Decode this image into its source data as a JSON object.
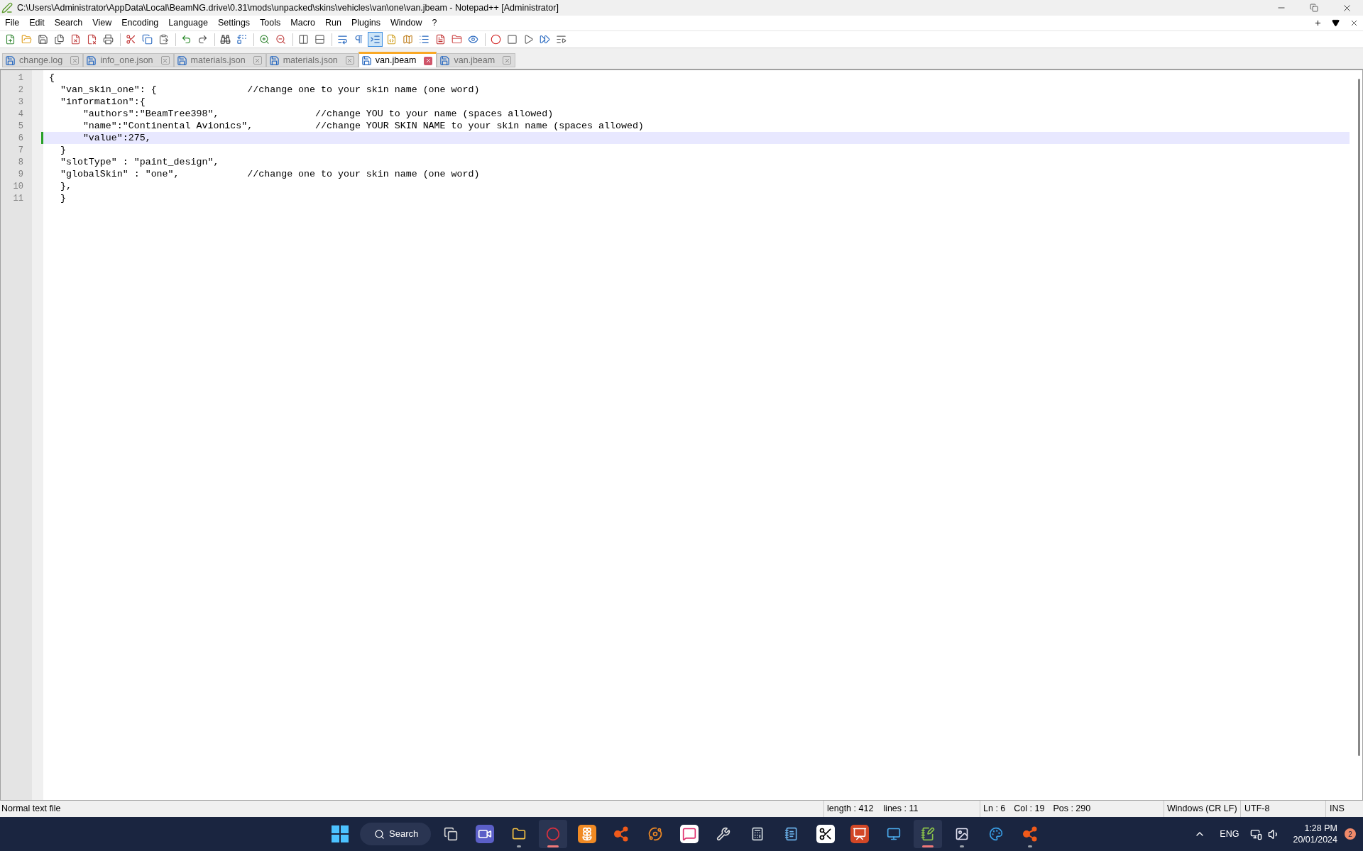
{
  "window": {
    "title": "C:\\Users\\Administrator\\AppData\\Local\\BeamNG.drive\\0.31\\mods\\unpacked\\skins\\vehicles\\van\\one\\van.jbeam - Notepad++ [Administrator]"
  },
  "menu": [
    "File",
    "Edit",
    "Search",
    "View",
    "Encoding",
    "Language",
    "Settings",
    "Tools",
    "Macro",
    "Run",
    "Plugins",
    "Window",
    "?"
  ],
  "toolbar": [
    {
      "kind": "new",
      "pressed": false
    },
    {
      "kind": "open",
      "pressed": false
    },
    {
      "kind": "save",
      "pressed": false
    },
    {
      "kind": "save-all",
      "pressed": false
    },
    {
      "kind": "close",
      "pressed": false
    },
    {
      "kind": "close-all",
      "pressed": false
    },
    {
      "kind": "print",
      "pressed": false
    },
    {
      "kind": "separator"
    },
    {
      "kind": "cut",
      "pressed": false
    },
    {
      "kind": "copy",
      "pressed": false
    },
    {
      "kind": "paste",
      "pressed": false
    },
    {
      "kind": "separator"
    },
    {
      "kind": "undo",
      "pressed": false
    },
    {
      "kind": "redo",
      "pressed": false
    },
    {
      "kind": "separator"
    },
    {
      "kind": "find",
      "pressed": false
    },
    {
      "kind": "replace",
      "pressed": false
    },
    {
      "kind": "separator"
    },
    {
      "kind": "zoom-in",
      "pressed": false
    },
    {
      "kind": "zoom-out",
      "pressed": false
    },
    {
      "kind": "separator"
    },
    {
      "kind": "sync-v",
      "pressed": false
    },
    {
      "kind": "sync-h",
      "pressed": false
    },
    {
      "kind": "separator"
    },
    {
      "kind": "wrap",
      "pressed": false
    },
    {
      "kind": "all-chars",
      "pressed": false
    },
    {
      "kind": "indent-guide",
      "pressed": true
    },
    {
      "kind": "udl",
      "pressed": false
    },
    {
      "kind": "doc-map",
      "pressed": false
    },
    {
      "kind": "doc-list",
      "pressed": false
    },
    {
      "kind": "function-list",
      "pressed": false
    },
    {
      "kind": "workspace",
      "pressed": false
    },
    {
      "kind": "monitor",
      "pressed": false
    },
    {
      "kind": "separator"
    },
    {
      "kind": "record",
      "pressed": false
    },
    {
      "kind": "stop",
      "pressed": false
    },
    {
      "kind": "play",
      "pressed": false
    },
    {
      "kind": "play-multi",
      "pressed": false
    },
    {
      "kind": "save-macro",
      "pressed": false
    }
  ],
  "tabs": [
    {
      "label": "change.log",
      "selected": false
    },
    {
      "label": "info_one.json",
      "selected": false
    },
    {
      "label": "materials.json",
      "selected": false
    },
    {
      "label": "materials.json",
      "selected": false
    },
    {
      "label": "van.jbeam",
      "selected": true
    },
    {
      "label": "van.jbeam",
      "selected": false
    }
  ],
  "editor": {
    "lines": [
      {
        "number": "1",
        "text": "{",
        "current": false,
        "changed": false
      },
      {
        "number": "2",
        "text": "  \"van_skin_one\": {                //change one to your skin name (one word)",
        "current": false,
        "changed": false
      },
      {
        "number": "3",
        "text": "  \"information\":{",
        "current": false,
        "changed": false
      },
      {
        "number": "4",
        "text": "      \"authors\":\"BeamTree398\",                 //change YOU to your name (spaces allowed)",
        "current": false,
        "changed": false
      },
      {
        "number": "5",
        "text": "      \"name\":\"Continental Avionics\",           //change YOUR SKIN NAME to your skin name (spaces allowed)",
        "current": false,
        "changed": false
      },
      {
        "number": "6",
        "text": "      \"value\":275,",
        "current": true,
        "changed": true
      },
      {
        "number": "7",
        "text": "  }",
        "current": false,
        "changed": false
      },
      {
        "number": "8",
        "text": "  \"slotType\" : \"paint_design\",",
        "current": false,
        "changed": false
      },
      {
        "number": "9",
        "text": "  \"globalSkin\" : \"one\",            //change one to your skin name (one word)",
        "current": false,
        "changed": false
      },
      {
        "number": "10",
        "text": "  },",
        "current": false,
        "changed": false
      },
      {
        "number": "11",
        "text": "  }",
        "current": false,
        "changed": false
      }
    ]
  },
  "status_bar": {
    "file_type": "Normal text file",
    "length": "length : 412",
    "lines": "lines : 11",
    "ln": "Ln : 6",
    "col": "Col : 19",
    "pos": "Pos : 290",
    "eol": "Windows (CR LF)",
    "encoding": "UTF-8",
    "mode": "INS"
  },
  "taskbar": {
    "search": "Search",
    "apps": [
      {
        "kind": "task-view",
        "running": false,
        "focused": false
      },
      {
        "kind": "meet",
        "running": false,
        "focused": false
      },
      {
        "kind": "files",
        "running": true,
        "focused": false
      },
      {
        "kind": "ring",
        "running": true,
        "focused": true
      },
      {
        "kind": "flower",
        "running": false,
        "focused": false
      },
      {
        "kind": "nodes",
        "running": false,
        "focused": false
      },
      {
        "kind": "orbit",
        "running": false,
        "focused": false
      },
      {
        "kind": "chat",
        "running": false,
        "focused": false
      },
      {
        "kind": "tools",
        "running": false,
        "focused": false
      },
      {
        "kind": "calculator",
        "running": false,
        "focused": false
      },
      {
        "kind": "notepad",
        "running": false,
        "focused": false
      },
      {
        "kind": "scissors",
        "running": false,
        "focused": false
      },
      {
        "kind": "presentation",
        "running": false,
        "focused": false
      },
      {
        "kind": "monitor",
        "running": false,
        "focused": false
      },
      {
        "kind": "notepadpp",
        "running": true,
        "focused": true
      },
      {
        "kind": "image",
        "running": true,
        "focused": false
      },
      {
        "kind": "palette",
        "running": false,
        "focused": false
      },
      {
        "kind": "nodes",
        "running": true,
        "focused": false
      }
    ],
    "language": "ENG",
    "time": "1:28 PM",
    "date": "20/01/2024",
    "notifications": "2"
  }
}
